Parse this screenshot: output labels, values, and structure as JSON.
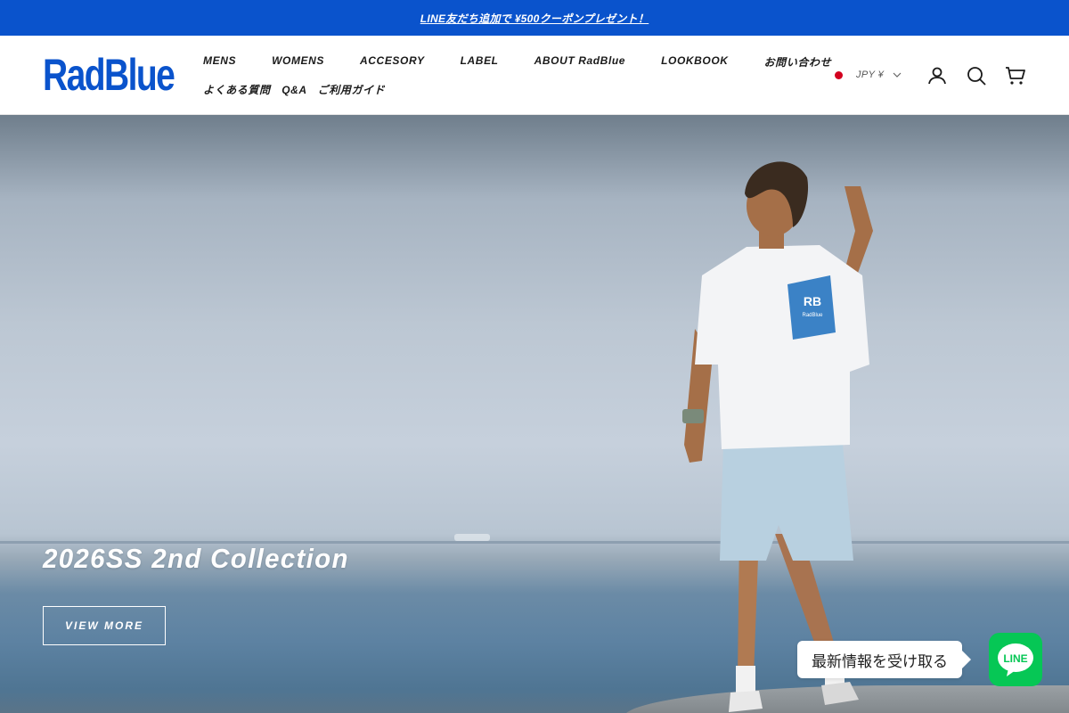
{
  "announcement": {
    "text": "LINE友だち追加で ¥500クーポンプレゼント！"
  },
  "header": {
    "logo": "RadBlue",
    "nav_row1": [
      "MENS",
      "WOMENS",
      "ACCESORY",
      "LABEL",
      "ABOUT RadBlue",
      "LOOKBOOK",
      "お問い合わせ"
    ],
    "nav_row2": [
      "よくある質問　Q&A",
      "ご利用ガイド"
    ],
    "currency": "JPY ¥",
    "icons": [
      "account-icon",
      "search-icon",
      "cart-icon"
    ]
  },
  "hero": {
    "title": "2026SS 2nd Collection",
    "button": "VIEW MORE",
    "tshirt_print": {
      "mark": "RB",
      "brand": "RadBlue"
    }
  },
  "line_widget": {
    "bubble": "最新情報を受け取る",
    "icon_text": "LINE"
  },
  "colors": {
    "brand_blue": "#0a53cc",
    "line_green": "#06c755",
    "flag_red": "#d3001f"
  }
}
